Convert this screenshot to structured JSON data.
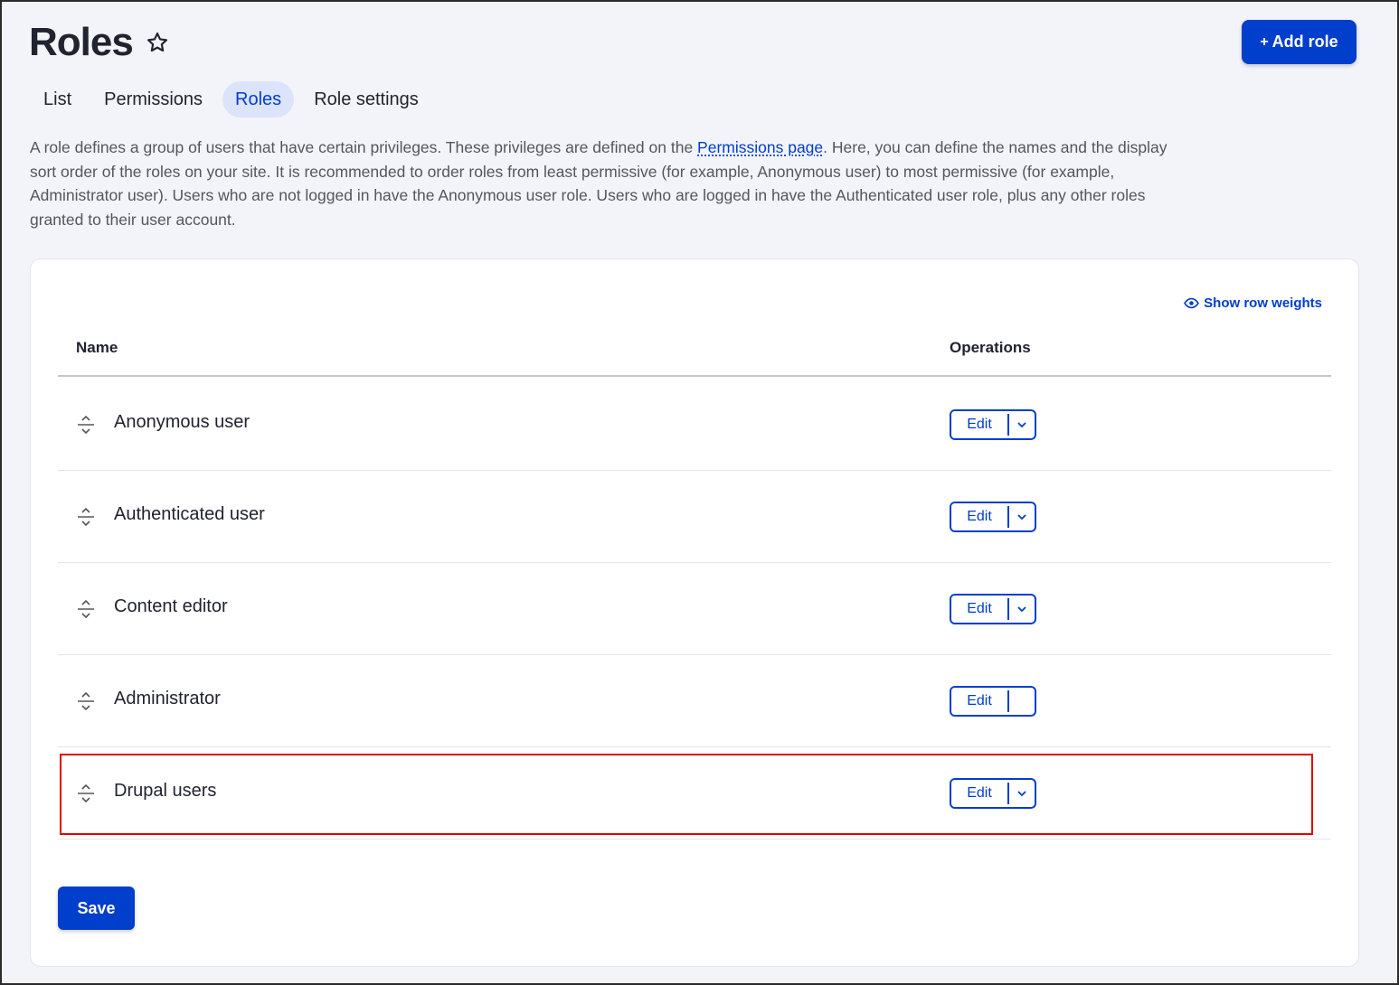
{
  "header": {
    "title": "Roles",
    "add_role_label": "Add role",
    "add_role_plus": "+"
  },
  "tabs": [
    {
      "label": "List",
      "active": false
    },
    {
      "label": "Permissions",
      "active": false
    },
    {
      "label": "Roles",
      "active": true
    },
    {
      "label": "Role settings",
      "active": false
    }
  ],
  "description": {
    "before_link": "A role defines a group of users that have certain privileges. These privileges are defined on the ",
    "link_text": "Permissions page",
    "after_link": ". Here, you can define the names and the display sort order of the roles on your site. It is recommended to order roles from least permissive (for example, Anonymous user) to most permissive (for example, Administrator user). Users who are not logged in have the Anonymous user role. Users who are logged in have the Authenticated user role, plus any other roles granted to their user account."
  },
  "table": {
    "show_weights_label": "Show row weights",
    "col_name": "Name",
    "col_operations": "Operations",
    "rows": [
      {
        "name": "Anonymous user",
        "edit_label": "Edit",
        "has_dropdown": true
      },
      {
        "name": "Authenticated user",
        "edit_label": "Edit",
        "has_dropdown": true
      },
      {
        "name": "Content editor",
        "edit_label": "Edit",
        "has_dropdown": true
      },
      {
        "name": "Administrator",
        "edit_label": "Edit",
        "has_dropdown": false
      },
      {
        "name": "Drupal users",
        "edit_label": "Edit",
        "has_dropdown": true
      }
    ]
  },
  "footer": {
    "save_label": "Save"
  },
  "colors": {
    "accent": "#003ecc",
    "highlight": "#e00000",
    "page_bg": "#f3f4f9"
  },
  "icons": {
    "title_star": "star-icon",
    "row_drag": "drag-handle-icon",
    "weights": "eye-icon",
    "dropdown": "chevron-down-icon"
  }
}
